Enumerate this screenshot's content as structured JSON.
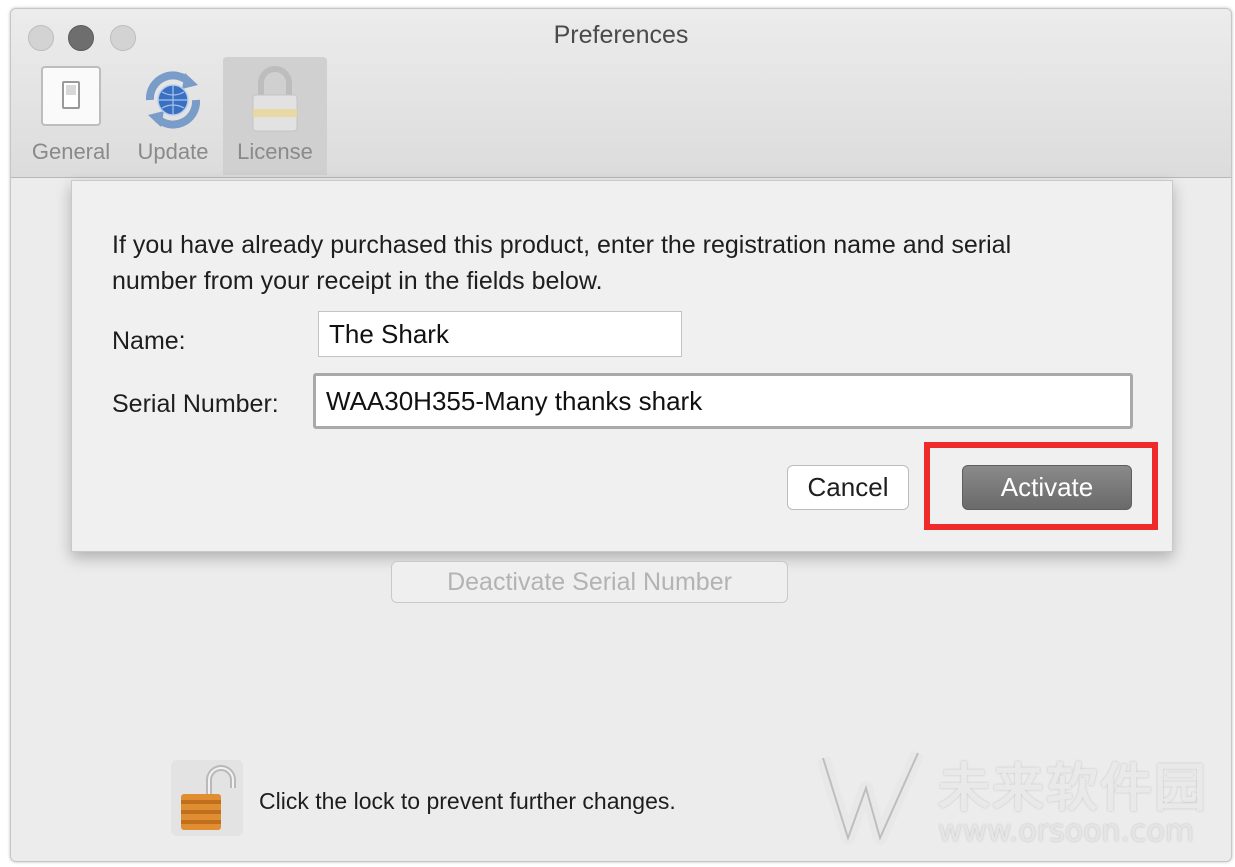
{
  "window": {
    "title": "Preferences"
  },
  "toolbar": {
    "tabs": [
      {
        "label": "General",
        "icon": "switch-icon"
      },
      {
        "label": "Update",
        "icon": "update-globe-icon"
      },
      {
        "label": "License",
        "icon": "padlock-icon",
        "selected": true
      }
    ]
  },
  "sheet": {
    "intro": "If you have already purchased this product, enter the registration name and serial number from your receipt in the fields below.",
    "name_label": "Name:",
    "name_value": "The Shark",
    "serial_label": "Serial Number:",
    "serial_value": "WAA30H355-Many thanks shark",
    "cancel_label": "Cancel",
    "activate_label": "Activate"
  },
  "panel": {
    "deactivate_label": "Deactivate Serial Number",
    "lock_text": "Click the lock to prevent further changes."
  },
  "watermark": {
    "brand": "未来软件园",
    "url": "www.orsoon.com"
  },
  "colors": {
    "highlight": "#ee2a2a",
    "activate": "#6e6e6e"
  }
}
